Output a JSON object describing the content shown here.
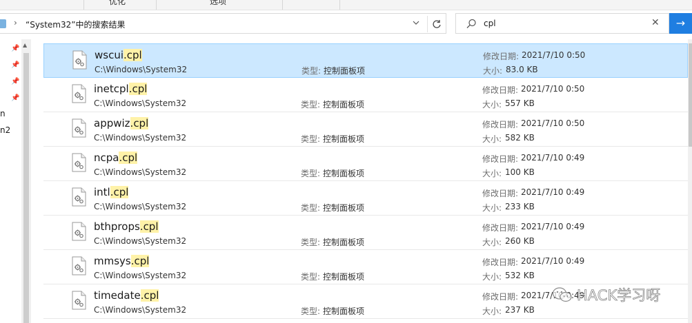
{
  "ribbon": {
    "tabs": [
      {
        "label": "优化"
      },
      {
        "label": "选项"
      }
    ]
  },
  "address": {
    "path_text": "“System32”中的搜索结果"
  },
  "search": {
    "query": "cpl"
  },
  "nav": {
    "fragments": [
      "n",
      "n2"
    ]
  },
  "results": [
    {
      "stem": "wscui",
      "ext": ".cpl",
      "path": "C:\\Windows\\System32",
      "type_label": "类型:",
      "type": "控制面板项",
      "date_label": "修改日期:",
      "date": "2021/7/10 0:50",
      "size_label": "大小:",
      "size": "83.0 KB"
    },
    {
      "stem": "inetcpl",
      "ext": ".cpl",
      "path": "C:\\Windows\\System32",
      "type_label": "类型:",
      "type": "控制面板项",
      "date_label": "修改日期:",
      "date": "2021/7/10 0:50",
      "size_label": "大小:",
      "size": "557 KB"
    },
    {
      "stem": "appwiz",
      "ext": ".cpl",
      "path": "C:\\Windows\\System32",
      "type_label": "类型:",
      "type": "控制面板项",
      "date_label": "修改日期:",
      "date": "2021/7/10 0:50",
      "size_label": "大小:",
      "size": "582 KB"
    },
    {
      "stem": "ncpa",
      "ext": ".cpl",
      "path": "C:\\Windows\\System32",
      "type_label": "类型:",
      "type": "控制面板项",
      "date_label": "修改日期:",
      "date": "2021/7/10 0:49",
      "size_label": "大小:",
      "size": "100 KB"
    },
    {
      "stem": "intl",
      "ext": ".cpl",
      "path": "C:\\Windows\\System32",
      "type_label": "类型:",
      "type": "控制面板项",
      "date_label": "修改日期:",
      "date": "2021/7/10 0:49",
      "size_label": "大小:",
      "size": "233 KB"
    },
    {
      "stem": "bthprops",
      "ext": ".cpl",
      "path": "C:\\Windows\\System32",
      "type_label": "类型:",
      "type": "控制面板项",
      "date_label": "修改日期:",
      "date": "2021/7/10 0:49",
      "size_label": "大小:",
      "size": "260 KB"
    },
    {
      "stem": "mmsys",
      "ext": ".cpl",
      "path": "C:\\Windows\\System32",
      "type_label": "类型:",
      "type": "控制面板项",
      "date_label": "修改日期:",
      "date": "2021/7/10 0:49",
      "size_label": "大小:",
      "size": "532 KB"
    },
    {
      "stem": "timedate",
      "ext": ".cpl",
      "path": "C:\\Windows\\System32",
      "type_label": "类型:",
      "type": "控制面板项",
      "date_label": "修改日期:",
      "date": "2021/7/10 0:49",
      "size_label": "大小:",
      "size": "237 KB"
    }
  ],
  "selected_index": 0,
  "watermark": {
    "text": "HACK学习呀"
  },
  "colors": {
    "selection_bg": "#cce8ff",
    "selection_border": "#99d1ff",
    "match_highlight": "#fff2a8",
    "search_button": "#1f7ee1"
  },
  "icons": {
    "address_folder": "folder-icon",
    "breadcrumb": "chevron-right-icon",
    "dropdown": "chevron-down-icon",
    "refresh": "refresh-icon",
    "search": "search-icon",
    "clear": "close-icon",
    "go": "arrow-right-icon",
    "pin": "pin-icon",
    "file": "cpl-file-icon"
  }
}
